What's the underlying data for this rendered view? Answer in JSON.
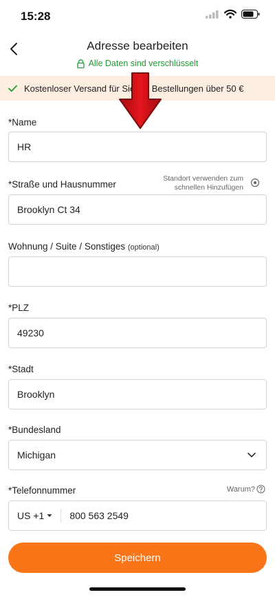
{
  "status": {
    "time": "15:28"
  },
  "header": {
    "title": "Adresse bearbeiten",
    "secure_text": "Alle Daten sind verschlüsselt"
  },
  "promo": {
    "text": "Kostenloser Versand für Sie bei Bestellungen über 50 €"
  },
  "form": {
    "name": {
      "label": "*Name",
      "value": "HR"
    },
    "street": {
      "label": "*Straße und Hausnummer",
      "value": "Brooklyn Ct 34",
      "location_hint_1": "Standort verwenden zum",
      "location_hint_2": "schnellen Hinzufügen"
    },
    "apartment": {
      "label": "Wohnung / Suite / Sonstiges",
      "optional": "(optional)",
      "value": ""
    },
    "zip": {
      "label": "*PLZ",
      "value": "49230"
    },
    "city": {
      "label": "*Stadt",
      "value": "Brooklyn"
    },
    "state": {
      "label": "*Bundesland",
      "value": "Michigan"
    },
    "phone": {
      "label": "*Telefonnummer",
      "why": "Warum?",
      "country_code": "US +1",
      "value": "800 563 2549"
    }
  },
  "actions": {
    "save_label": "Speichern"
  },
  "colors": {
    "accent": "#f97518",
    "secure_green": "#1f9a36",
    "promo_bg": "#fdeee2",
    "arrow_red": "#d8141a"
  }
}
